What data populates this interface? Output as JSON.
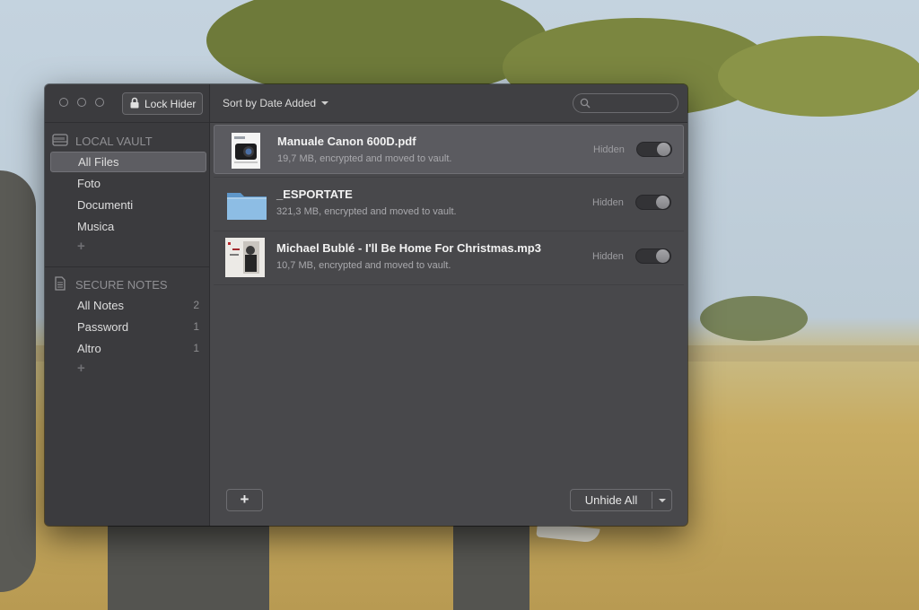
{
  "toolbar": {
    "lock_label": "Lock Hider",
    "sort_label": "Sort by Date Added"
  },
  "sidebar": {
    "vault_header": "LOCAL VAULT",
    "vault_items": [
      {
        "label": "All Files",
        "selected": true
      },
      {
        "label": "Foto"
      },
      {
        "label": "Documenti"
      },
      {
        "label": "Musica"
      }
    ],
    "notes_header": "SECURE NOTES",
    "notes_items": [
      {
        "label": "All Notes",
        "count": "2"
      },
      {
        "label": "Password",
        "count": "1"
      },
      {
        "label": "Altro",
        "count": "1"
      }
    ],
    "add_symbol": "+"
  },
  "files": [
    {
      "name": "Manuale Canon 600D.pdf",
      "meta": "19,7 MB, encrypted and moved to vault.",
      "status": "Hidden",
      "icon": "pdf-document-icon"
    },
    {
      "name": "_ESPORTATE",
      "meta": "321,3 MB, encrypted and moved to vault.",
      "status": "Hidden",
      "icon": "folder-icon"
    },
    {
      "name": "Michael Bublé - I'll Be Home For Christmas.mp3",
      "meta": "10,7 MB, encrypted and moved to vault.",
      "status": "Hidden",
      "icon": "album-art-icon"
    }
  ],
  "footer": {
    "add_label": "+",
    "unhide_label": "Unhide All"
  },
  "colors": {
    "window_bg": "#48484b",
    "sidebar_bg": "#3b3b3e",
    "selection": "#5d5d62",
    "folder": "#7fb3de"
  }
}
